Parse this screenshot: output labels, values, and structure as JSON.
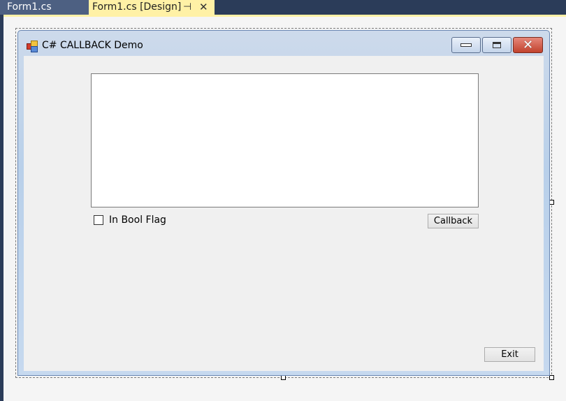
{
  "ide": {
    "tabs": [
      {
        "label": "Form1.cs",
        "active": false
      },
      {
        "label": "Form1.cs [Design]",
        "active": true
      }
    ],
    "pin_glyph": "⊣",
    "close_glyph": "✕"
  },
  "form": {
    "title": "C# CALLBACK Demo",
    "icon": "form-app-icon",
    "caption_buttons": {
      "minimize_icon": "minimize-icon",
      "maximize_icon": "maximize-icon",
      "close_glyph": "✕"
    },
    "textbox_value": "",
    "checkbox": {
      "label": "In Bool Flag",
      "checked": false
    },
    "callback_button_label": "Callback",
    "exit_button_label": "Exit"
  },
  "colors": {
    "tab_active": "#fff1a6",
    "tab_inactive": "#4d6082",
    "ide_background": "#2b3c59",
    "form_client": "#f0f0f0"
  }
}
